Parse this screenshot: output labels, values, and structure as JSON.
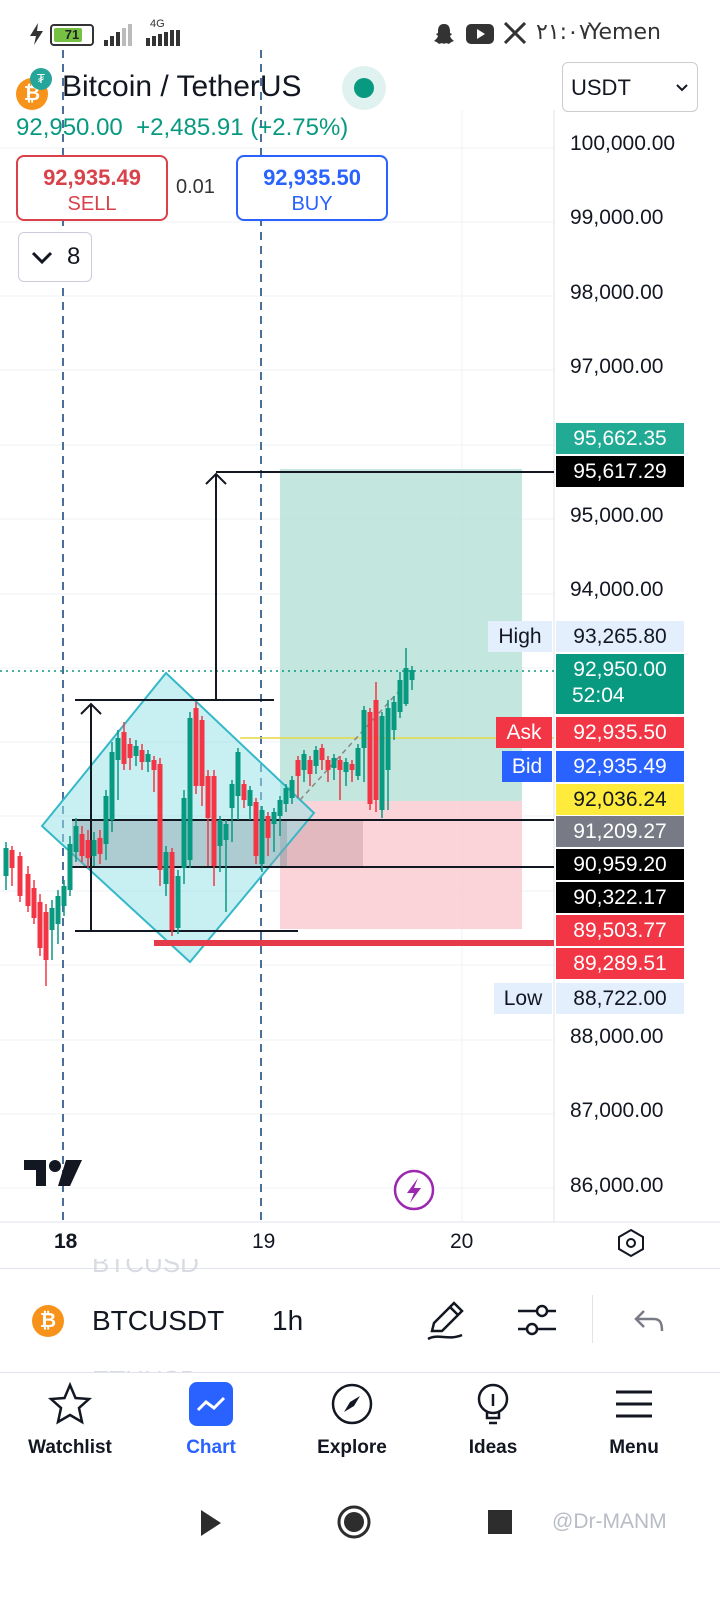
{
  "status_bar": {
    "battery": "71",
    "network": "4G",
    "time": "٢١:٠٧",
    "carrier": "Yemen"
  },
  "header": {
    "coin_icon": "bitcoin-icon",
    "title": "Bitcoin / TetherUS",
    "price": "92,950.00",
    "change": "+2,485.91 (+2.75%)",
    "currency": "USDT",
    "sell_price": "92,935.49",
    "sell_label": "SELL",
    "quantity": "0.01",
    "buy_price": "92,935.50",
    "buy_label": "BUY",
    "collapse_count": "8"
  },
  "colors": {
    "up": "#089981",
    "down": "#f23645",
    "accent": "#2962ff",
    "target_zone": "#b2dfd4",
    "stop_zone": "#f8c8cc",
    "pattern": "#90e0e6"
  },
  "price_axis": {
    "labels": [
      "100,000.00",
      "99,000.00",
      "98,000.00",
      "97,000.00",
      "95,000.00",
      "94,000.00",
      "88,000.00",
      "87,000.00",
      "86,000.00"
    ]
  },
  "price_tags": {
    "target_green": "95,662.35",
    "target_black": "95,617.29",
    "high_label": "High",
    "high": "93,265.80",
    "last": "92,950.00",
    "countdown": "52:04",
    "ask_label": "Ask",
    "ask": "92,935.50",
    "bid_label": "Bid",
    "bid": "92,935.49",
    "yellow": "92,036.24",
    "grey": "91,209.27",
    "black1": "90,959.20",
    "black2": "90,322.17",
    "red1": "89,503.77",
    "red2": "89,289.51",
    "low_label": "Low",
    "low": "88,722.00"
  },
  "time_axis": {
    "labels": [
      "18",
      "19",
      "20"
    ]
  },
  "toolbar": {
    "symbol": "BTCUSDT",
    "interval": "1h",
    "ghost_above": "BTCUSD",
    "ghost_below": "ETHUSD"
  },
  "tabs": [
    {
      "label": "Watchlist",
      "icon": "star-icon"
    },
    {
      "label": "Chart",
      "icon": "chart-icon"
    },
    {
      "label": "Explore",
      "icon": "compass-icon"
    },
    {
      "label": "Ideas",
      "icon": "lightbulb-icon"
    },
    {
      "label": "Menu",
      "icon": "menu-icon"
    }
  ],
  "watermark": "@Dr-MANM"
}
